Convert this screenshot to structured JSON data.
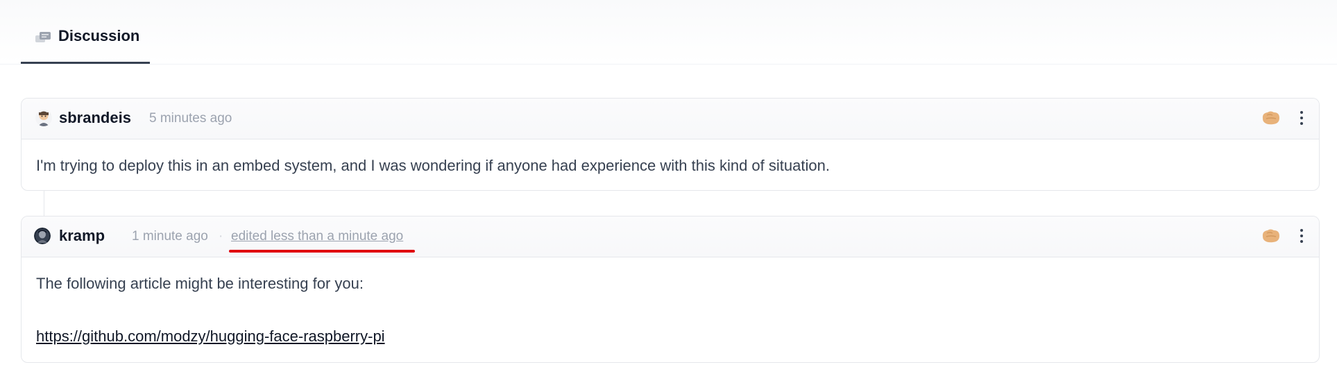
{
  "tabs": [
    {
      "label": "Discussion",
      "icon": "discussion-icon",
      "active": true
    }
  ],
  "comments": [
    {
      "author": "sbrandeis",
      "time": "5 minutes ago",
      "edited": "",
      "body": "I'm trying to deploy this in an embed system, and I was wondering if anyone had experience with this kind of situation.",
      "link": ""
    },
    {
      "author": "kramp",
      "time": "1 minute ago",
      "separator": "·",
      "edited": "edited less than a minute ago",
      "body": "The following article might be interesting for you:",
      "link": "https://github.com/modzy/hugging-face-raspberry-pi"
    }
  ],
  "colors": {
    "annotation_underline": "#e0000b",
    "reaction": "#e8b27a"
  }
}
